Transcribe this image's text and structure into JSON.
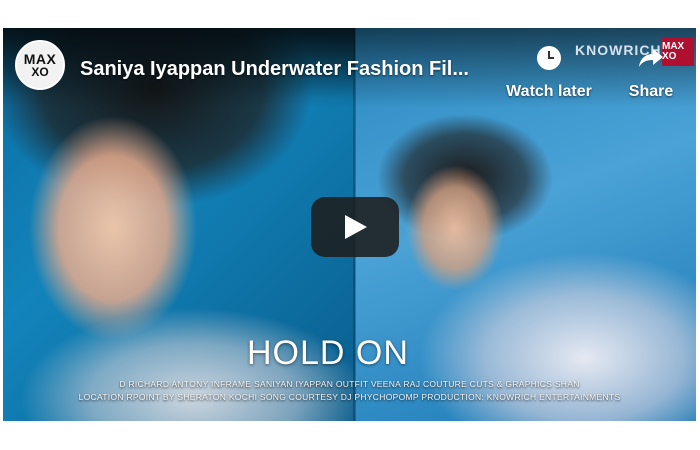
{
  "video": {
    "title": "Saniya Iyappan Underwater Fashion Fil...",
    "channel_logo_line1": "MAX",
    "channel_logo_line2": "XO",
    "watch_later_label": "Watch later",
    "share_label": "Share",
    "brand_mark": "KNOWRICH",
    "corner_logo": "MAX XO"
  },
  "overlay": {
    "song_title": "HOLD ON",
    "credits_line1": "D    RICHARD ANTONY INFRAME  SANIYAN IYAPPAN OUTFIT VEENA RAJ COUTURE CUTS & GRAPHICS SHAN",
    "credits_line2": "LOCATION  RPOINT BY SHERATON KOCHI SONG COURTESY DJ PHYCHOPOMP PRODUCTION: KNOWRICH ENTERTAINMENTS"
  },
  "colors": {
    "play_button_bg": "#1e1e1e",
    "corner_logo_bg": "#b01030"
  },
  "icons": {
    "play": "play-icon",
    "watch_later": "clock-icon",
    "share": "share-arrow-icon"
  }
}
